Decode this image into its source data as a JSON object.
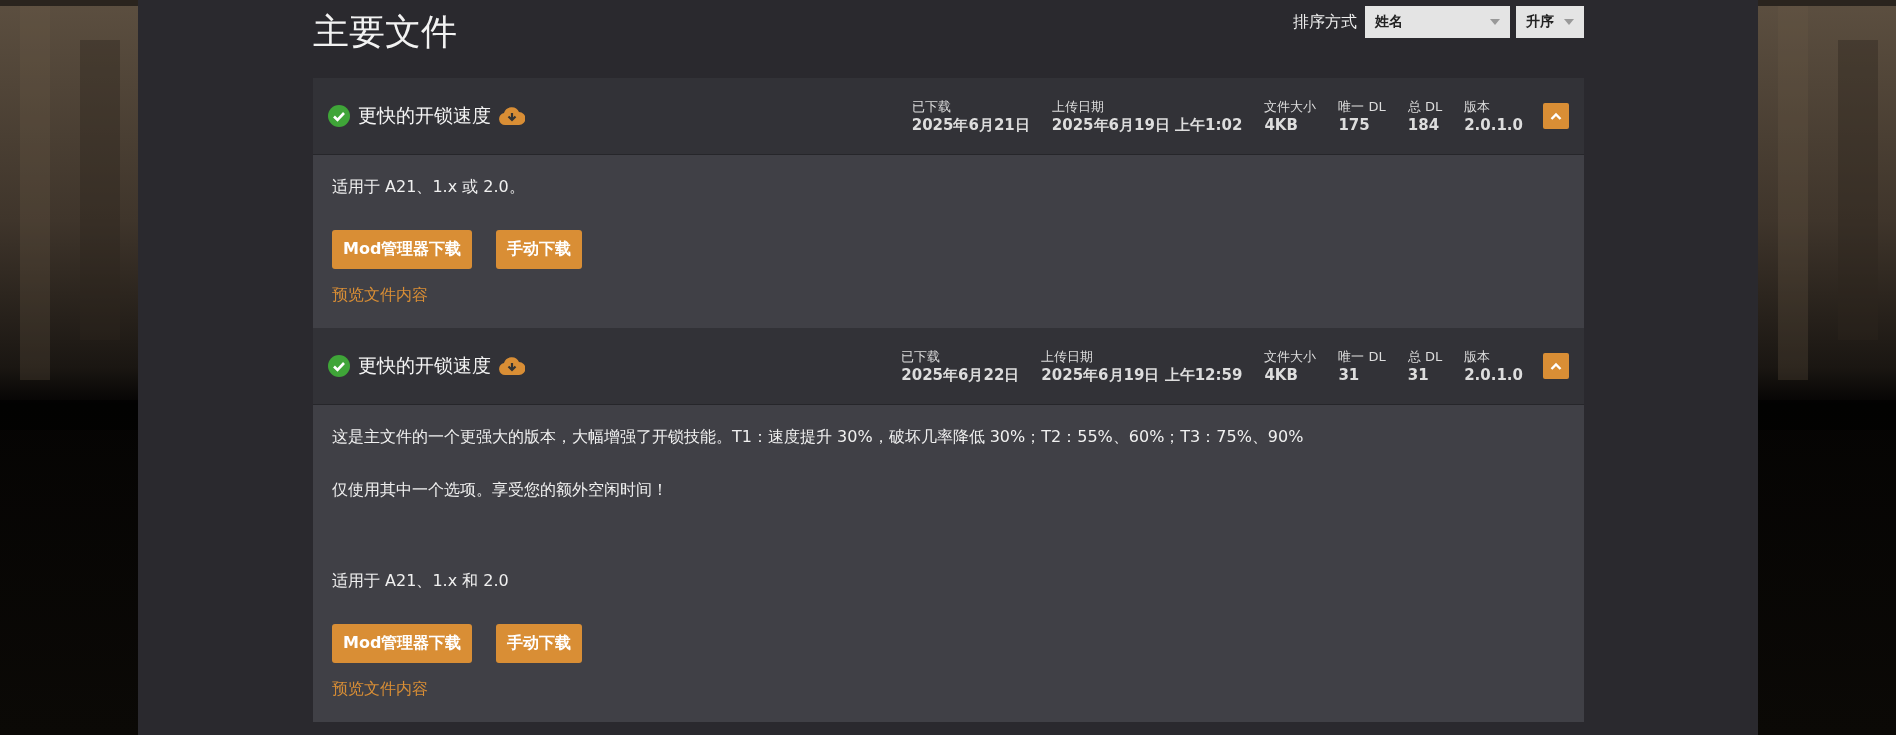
{
  "title": "主要文件",
  "sort": {
    "label": "排序方式",
    "selects": [
      {
        "value": "姓名"
      },
      {
        "value": "升序"
      }
    ]
  },
  "files": [
    {
      "name": "更快的开锁速度",
      "expanded": true,
      "meta": [
        {
          "label": "已下载",
          "value": "2025年6月21日"
        },
        {
          "label": "上传日期",
          "value": "2025年6月19日 上午1:02"
        },
        {
          "label": "文件大小",
          "value": "4KB"
        },
        {
          "label": "唯一 DL",
          "value": "175"
        },
        {
          "label": "总 DL",
          "value": "184"
        },
        {
          "label": "版本",
          "value": "2.0.1.0"
        }
      ],
      "description": [
        "适用于 A21、1.x 或 2.0。"
      ],
      "buttons": [
        "Mod管理器下载",
        "手动下载"
      ],
      "preview_link": "预览文件内容"
    },
    {
      "name": "更快的开锁速度",
      "expanded": true,
      "meta": [
        {
          "label": "已下载",
          "value": "2025年6月22日"
        },
        {
          "label": "上传日期",
          "value": "2025年6月19日 上午12:59"
        },
        {
          "label": "文件大小",
          "value": "4KB"
        },
        {
          "label": "唯一 DL",
          "value": "31"
        },
        {
          "label": "总 DL",
          "value": "31"
        },
        {
          "label": "版本",
          "value": "2.0.1.0"
        }
      ],
      "description": [
        "这是主文件的一个更强大的版本，大幅增强了开锁技能。T1：速度提升 30%，破坏几率降低 30%；T2：55%、60%；T3：75%、90%",
        "仅使用其中一个选项。享受您的额外空闲时间！",
        "适用于 A21、1.x 和 2.0"
      ],
      "buttons": [
        "Mod管理器下载",
        "手动下载"
      ],
      "preview_link": "预览文件内容"
    }
  ]
}
